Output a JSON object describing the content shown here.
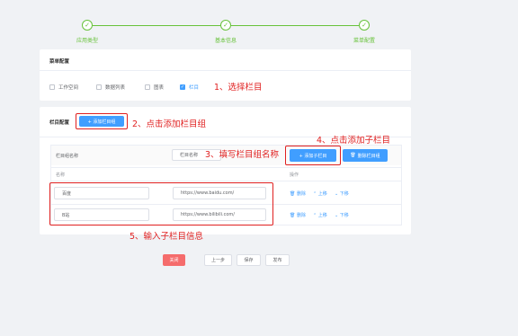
{
  "steps": [
    {
      "label": "应用类型",
      "icon": "check-icon"
    },
    {
      "label": "基本信息",
      "icon": "check-icon"
    },
    {
      "label": "菜单配置",
      "icon": "check-icon"
    }
  ],
  "menu_config": {
    "title": "菜单配置",
    "options": [
      "工作空间",
      "数据列表",
      "图表",
      "栏目"
    ],
    "checked": "栏目"
  },
  "column_config": {
    "title": "栏目配置",
    "add_group_button": "+ 添加栏目组",
    "group_name_label": "栏目组名称",
    "group_name_input_placeholder": "栏目名称",
    "add_sub_button": "+ 添加子栏目",
    "delete_group_button": "删除栏目组",
    "columns": {
      "name": "名称",
      "operation": "操作"
    },
    "rows": [
      {
        "name": "百度",
        "url": "https://www.baidu.com/"
      },
      {
        "name": "B站",
        "url": "https://www.bilibili.com/"
      }
    ],
    "row_actions": {
      "delete": "删除",
      "up": "上移",
      "down": "下移"
    }
  },
  "annotations": {
    "a1": "1、选择栏目",
    "a2": "2、点击添加栏目组",
    "a3": "3、填写栏目组名称",
    "a4": "4、点击添加子栏目",
    "a5": "5、输入子栏目信息"
  },
  "footer": {
    "close": "关闭",
    "prev": "上一步",
    "save": "保存",
    "publish": "发布"
  },
  "colors": {
    "primary": "#409eff",
    "success": "#67c23a",
    "danger": "#f56c6c",
    "annotation": "#e02020"
  }
}
